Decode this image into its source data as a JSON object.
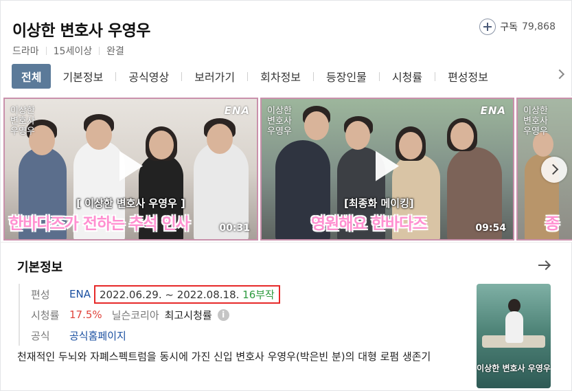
{
  "header": {
    "title": "이상한 변호사 우영우",
    "meta": [
      "드라마",
      "15세이상",
      "완결"
    ],
    "subscribe_label": "구독",
    "subscribe_count": "79,868"
  },
  "tabs": {
    "active": "전체",
    "items": [
      "기본정보",
      "공식영상",
      "보러가기",
      "회차정보",
      "등장인물",
      "시청률",
      "편성정보"
    ]
  },
  "clips": [
    {
      "channel": "ENA",
      "logo": "이상한 변호사 우영우",
      "caption_small": "[ 이상한 변호사 우영우 ]",
      "caption_big": "한바다즈가 전하는 추석 인사",
      "duration": "00:31"
    },
    {
      "channel": "ENA",
      "logo": "이상한 변호사 우영우",
      "caption_small": "[최종화 메이킹]",
      "caption_big": "영원해요 한바다즈",
      "duration": "09:54"
    },
    {
      "logo": "이상한 변호사 우영우",
      "caption_big": "종"
    }
  ],
  "basic_info": {
    "section_title": "기본정보",
    "broadcast_label": "편성",
    "broadcast_channel": "ENA",
    "dates": "2022.06.29. ~ 2022.08.18.",
    "episodes": "16부작",
    "rating_label": "시청률",
    "rating_value": "17.5%",
    "rating_source": "닐슨코리아",
    "rating_type": "최고시청률",
    "official_label": "공식",
    "official_link": "공식홈페이지",
    "description": "천재적인 두뇌와 자폐스펙트럼을 동시에 가진 신입 변호사 우영우(박은빈 분)의 대형 로펌 생존기",
    "poster_title": "이상한 변호사 우영우"
  },
  "colors": {
    "tab_active_bg": "#5b7a99",
    "link_blue": "#1a4fa0",
    "rating_red": "#e0443c",
    "episodes_green": "#2d9a3e",
    "highlight_border": "#e62828",
    "clip_border": "#c990ab"
  }
}
